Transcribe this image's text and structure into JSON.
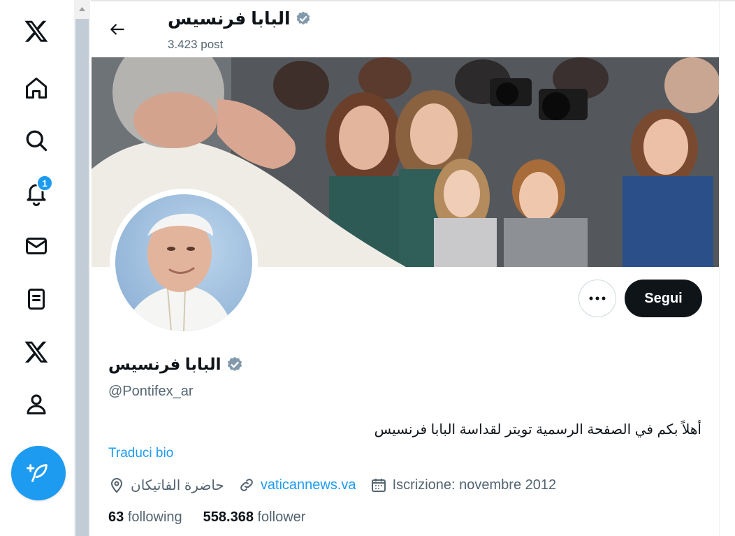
{
  "nav": {
    "items": [
      {
        "icon": "x-logo-icon"
      },
      {
        "icon": "home-icon"
      },
      {
        "icon": "search-icon"
      },
      {
        "icon": "bell-icon"
      },
      {
        "icon": "mail-icon"
      },
      {
        "icon": "list-icon"
      },
      {
        "icon": "x-premium-icon"
      },
      {
        "icon": "profile-icon"
      }
    ],
    "notification_badge": "1",
    "post_button_icon": "feather-plus-icon"
  },
  "header": {
    "name": "البابا فرنسيس",
    "post_count": "3.423 post"
  },
  "actions": {
    "more": "···",
    "follow_label": "Segui"
  },
  "profile": {
    "name": "البابا فرنسيس",
    "handle": "@Pontifex_ar",
    "bio": "أهلاً بكم في الصفحة الرسمية تويتر لقداسة البابا فرنسيس",
    "translate_label": "Traduci bio",
    "location": "حاضرة الفاتيكان",
    "website": "vaticannews.va",
    "joined": "Iscrizione: novembre 2012",
    "following_count": "63",
    "following_label": "following",
    "followers_count": "558.368",
    "followers_label": "follower"
  },
  "colors": {
    "accent": "#1d9bf0",
    "text": "#0f1419",
    "muted": "#536471",
    "verified": "#829aab"
  }
}
